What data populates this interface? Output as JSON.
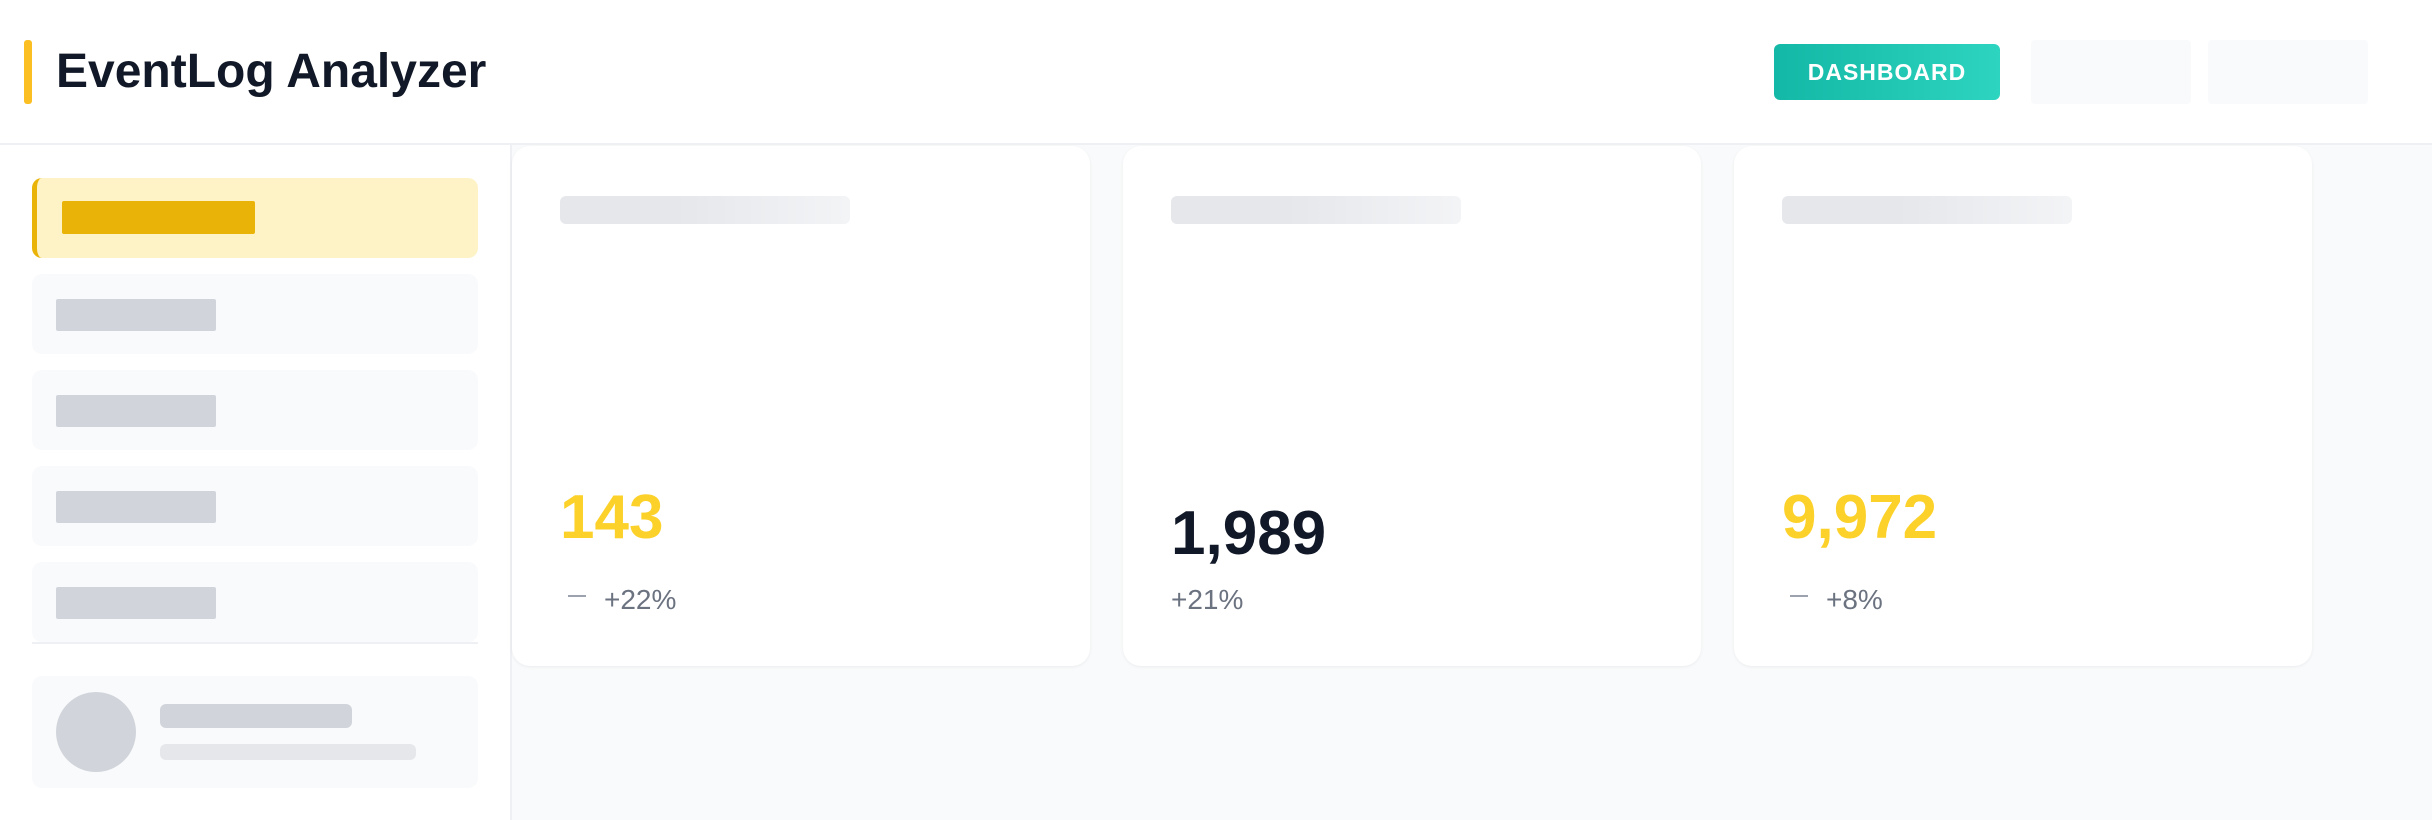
{
  "header": {
    "title": "EventLog Analyzer",
    "dashboard_label": "DASHBOARD",
    "accent_color": "#fbbf24",
    "button_color": "#14b8a6"
  },
  "sidebar": {
    "items": [
      {
        "label": "",
        "active": true
      },
      {
        "label": "",
        "active": false
      },
      {
        "label": "",
        "active": false
      },
      {
        "label": "",
        "active": false
      },
      {
        "label": "",
        "active": false
      }
    ],
    "user": {
      "name": "",
      "subtitle": ""
    }
  },
  "cards": [
    {
      "value": "143",
      "change": "+22%",
      "value_color": "#fcd12a",
      "icon": "dash-icon"
    },
    {
      "value": "1,989",
      "change": "+21%",
      "value_color": "#111827"
    },
    {
      "value": "9,972",
      "change": "+8%",
      "value_color": "#fcd12a",
      "icon": "dash-icon"
    }
  ]
}
